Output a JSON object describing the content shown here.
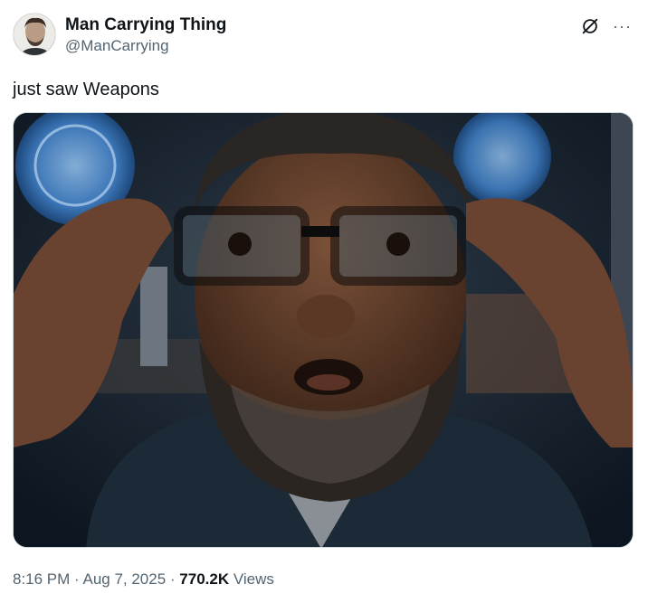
{
  "author": {
    "display_name": "Man Carrying Thing",
    "handle": "@ManCarrying",
    "avatar_icon": "profile-photo"
  },
  "tweet": {
    "text": "just saw Weapons"
  },
  "actions": {
    "grok_icon": "grok-icon",
    "more_icon": "more-options-icon",
    "more_label": "···"
  },
  "meta": {
    "time": "8:16 PM",
    "sep1": " · ",
    "date": "Aug 7, 2025",
    "sep2": " · ",
    "views_count": "770.2K",
    "views_label": " Views"
  },
  "colors": {
    "text": "#0f1419",
    "secondary": "#536471",
    "border": "#cfd9de"
  }
}
